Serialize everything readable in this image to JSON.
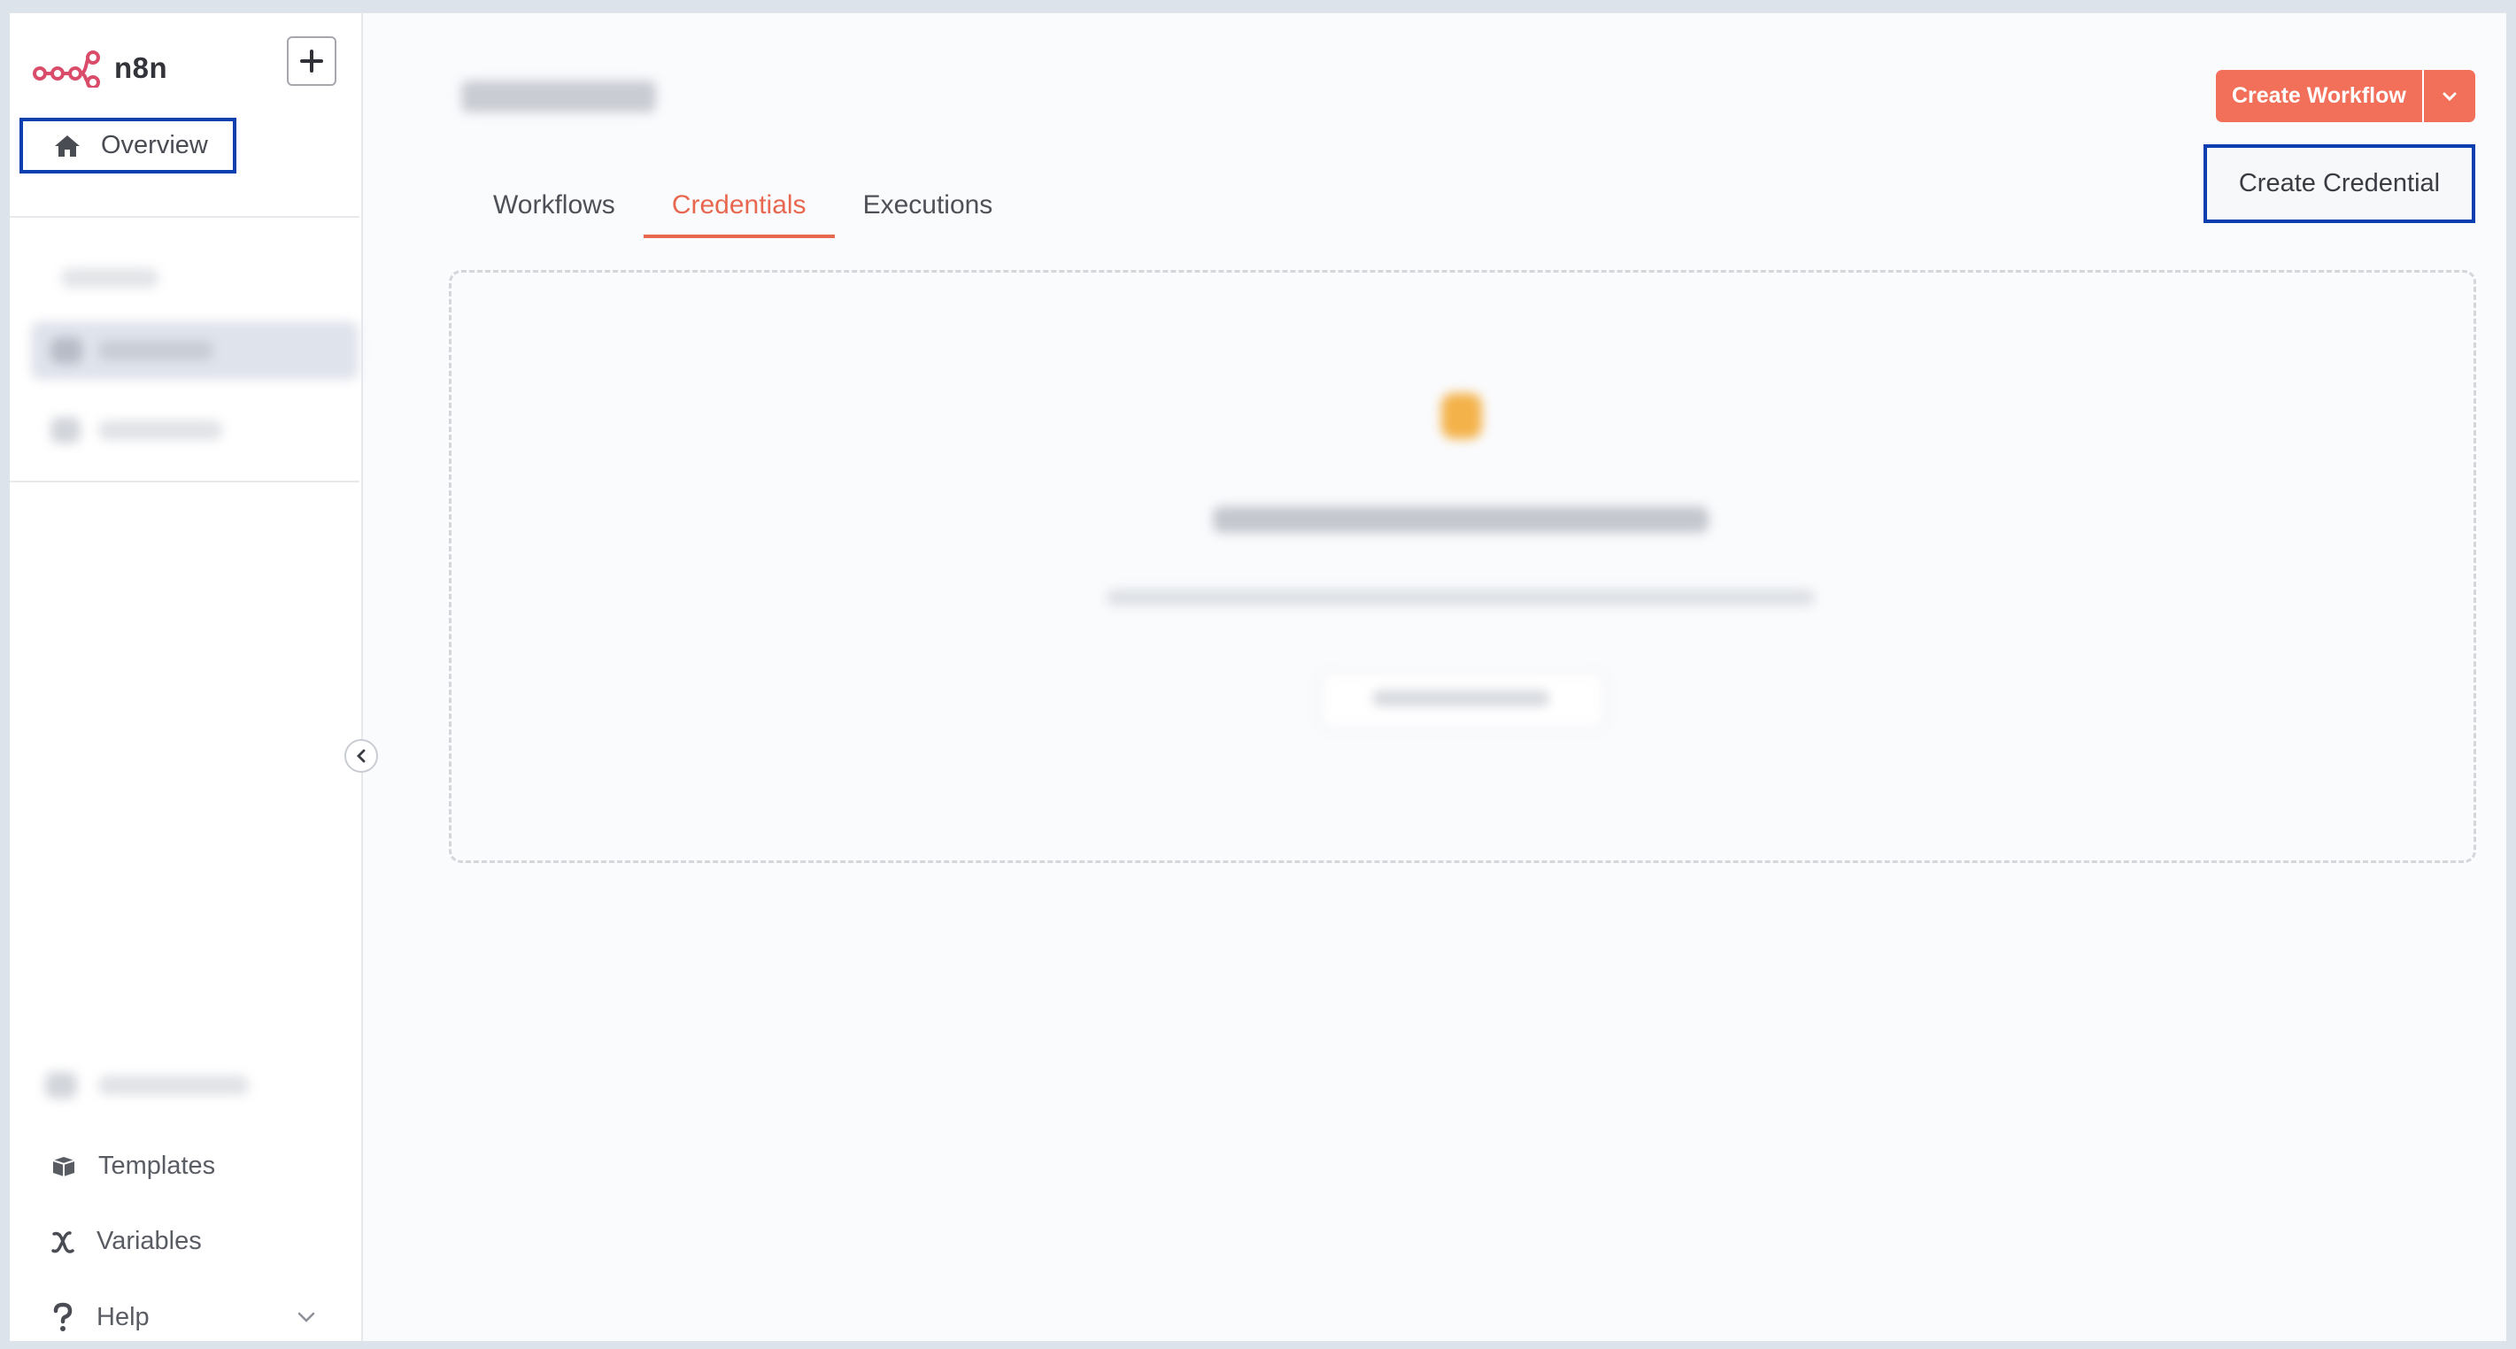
{
  "brand": {
    "name": "n8n",
    "logo_color": "#d94d6a"
  },
  "sidebar": {
    "overview_label": "Overview",
    "bottom_items": [
      {
        "label": "Templates",
        "icon": "box-icon"
      },
      {
        "label": "Variables",
        "icon": "variable-icon"
      },
      {
        "label": "Help",
        "icon": "question-icon"
      }
    ]
  },
  "tabs": [
    {
      "label": "Workflows",
      "active": false
    },
    {
      "label": "Credentials",
      "active": true
    },
    {
      "label": "Executions",
      "active": false
    }
  ],
  "actions": {
    "create_workflow": "Create Workflow",
    "create_credential": "Create Credential"
  },
  "colors": {
    "accent": "#f2705a",
    "active_tab": "#e8674f",
    "highlight_border": "#0b3fb0"
  }
}
